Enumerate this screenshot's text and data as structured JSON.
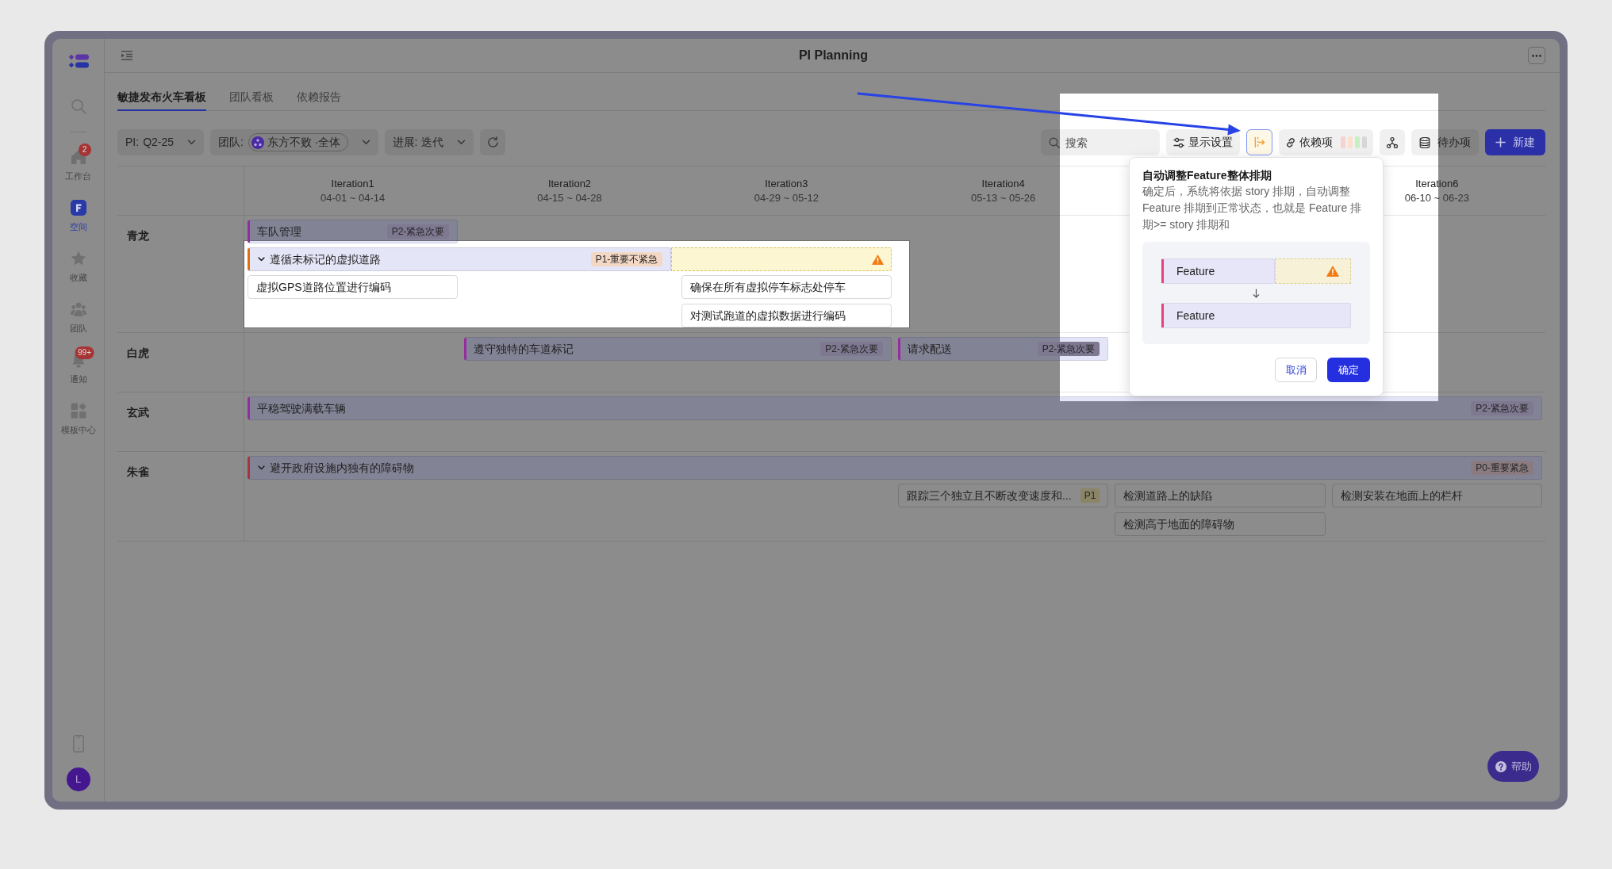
{
  "window": {
    "title": "PI Planning"
  },
  "sidebar": {
    "items": [
      {
        "label": "工作台",
        "badge": "2",
        "selected": false
      },
      {
        "label": "空间",
        "selected": true
      },
      {
        "label": "收藏",
        "selected": false
      },
      {
        "label": "团队",
        "selected": false
      },
      {
        "label": "通知",
        "badge": "99+",
        "selected": false
      },
      {
        "label": "模板中心",
        "selected": false
      }
    ],
    "avatar": "L"
  },
  "tabs": [
    {
      "label": "敏捷发布火车看板",
      "selected": true
    },
    {
      "label": "团队看板",
      "selected": false
    },
    {
      "label": "依赖报告",
      "selected": false
    }
  ],
  "filters": [
    {
      "kind": "plain",
      "label": "PI:",
      "value": "Q2-25"
    },
    {
      "kind": "team",
      "label": "团队:",
      "value": "东方不败 ·全体"
    },
    {
      "kind": "plain",
      "label": "进展:",
      "value": "迭代"
    }
  ],
  "toolbar": {
    "search": {
      "placeholder": "搜索"
    },
    "display_settings": "显示设置",
    "auto_schedule": {
      "highlighted": true
    },
    "dependencies": {
      "label": "依赖项",
      "indicators": [
        {
          "color": "#f6d3d1"
        },
        {
          "color": "#fbe0cb"
        },
        {
          "color": "#c8eec3"
        },
        {
          "color": "#d7d7d7"
        }
      ]
    },
    "backlog": "待办项",
    "create": "新建"
  },
  "board": {
    "iterations": [
      {
        "kind": "iteration",
        "name": "Iteration1",
        "dates": "04-01 ~ 04-14"
      },
      {
        "kind": "iteration",
        "name": "Iteration2",
        "dates": "04-15 ~ 04-28"
      },
      {
        "kind": "iteration",
        "name": "Iteration3",
        "dates": "04-29 ~ 05-12"
      },
      {
        "kind": "iteration",
        "name": "Iteration4",
        "dates": "05-13 ~ 05-26"
      },
      {
        "kind": "covered"
      },
      {
        "kind": "iteration",
        "name": "Iteration6",
        "dates": "06-10 ~ 06-23"
      }
    ],
    "swimlanes": [
      {
        "team": "青龙",
        "lanes": [
          [
            {
              "kind": "feature",
              "title": "车队管理",
              "tag": {
                "text": "P2-紧急次要",
                "color": "#7f7891"
              },
              "color": "#952c9f"
            }
          ],
          [
            {
              "kind": "feature",
              "title": "遵循未标记的虚拟道路",
              "tag": {
                "text": "P1-重要不紧急",
                "color": "#f3d8c6"
              },
              "color": "#e0700f",
              "expanded": true,
              "stories": [
                [
                  {
                    "kind": "story",
                    "title": "虚拟GPS道路位置进行编码"
                  },
                  {
                    "kind": "empty"
                  },
                  {
                    "kind": "story",
                    "title": "确保在所有虚拟停车标志处停车"
                  }
                ],
                [
                  {
                    "kind": "empty"
                  },
                  {
                    "kind": "empty"
                  },
                  {
                    "kind": "story",
                    "title": "对测试跑道的虚拟数据进行编码"
                  }
                ]
              ]
            },
            {
              "kind": "continued"
            },
            {
              "kind": "overrun"
            }
          ]
        ]
      },
      {
        "team": "白虎",
        "lanes": [
          [
            {
              "kind": "empty"
            },
            {
              "kind": "feature",
              "title": "遵守独特的车道标记",
              "tag": {
                "text": "P2-紧急次要",
                "color": "#7f7891"
              },
              "color": "#952c9f"
            },
            {
              "kind": "continued"
            },
            {
              "kind": "feature",
              "title": "请求配送",
              "tag": {
                "text": "P2-紧急次要",
                "color": "#7f7891"
              },
              "color": "#952c9f"
            }
          ]
        ]
      },
      {
        "team": "玄武",
        "lanes": [
          [
            {
              "kind": "feature",
              "title": "平稳驾驶满载车辆",
              "tag": {
                "text": "P2-紧急次要",
                "color": "#7f7891"
              },
              "color": "#952c9f"
            },
            {
              "kind": "continued"
            },
            {
              "kind": "continued"
            },
            {
              "kind": "continued"
            },
            {
              "kind": "continued"
            },
            {
              "kind": "continued"
            }
          ]
        ]
      },
      {
        "team": "朱雀",
        "lanes": [
          [
            {
              "kind": "feature",
              "title": "避开政府设施内独有的障碍物",
              "tag": {
                "text": "P0-重要紧急",
                "color": "#8a7b80"
              },
              "color": "#a8333c",
              "expanded": true,
              "stories": [
                [
                  {
                    "kind": "empty"
                  },
                  {
                    "kind": "empty"
                  },
                  {
                    "kind": "empty"
                  },
                  {
                    "kind": "story",
                    "title": "跟踪三个独立且不断改变速度和...",
                    "tag": {
                      "text": "P1",
                      "color": "#8b8466"
                    }
                  },
                  {
                    "kind": "story",
                    "title": "检测道路上的缺陷"
                  },
                  {
                    "kind": "story",
                    "title": "检测安装在地面上的栏杆"
                  }
                ],
                [
                  {
                    "kind": "empty"
                  },
                  {
                    "kind": "empty"
                  },
                  {
                    "kind": "empty"
                  },
                  {
                    "kind": "empty"
                  },
                  {
                    "kind": "story",
                    "title": "检测高于地面的障碍物"
                  }
                ]
              ]
            },
            {
              "kind": "continued"
            },
            {
              "kind": "continued"
            },
            {
              "kind": "continued"
            },
            {
              "kind": "continued"
            },
            {
              "kind": "continued"
            }
          ]
        ]
      }
    ]
  },
  "popover": {
    "title": "自动调整Feature整体排期",
    "description": "确定后，系统将依据 story 排期，自动调整 Feature 排期到正常状态，也就是 Feature 排期>= story 排期和",
    "example": {
      "before": {
        "label": "Feature",
        "warning": true
      },
      "after": {
        "label": "Feature",
        "warning": false
      }
    },
    "cancel": "取消",
    "confirm": "确定"
  },
  "help": "帮助"
}
